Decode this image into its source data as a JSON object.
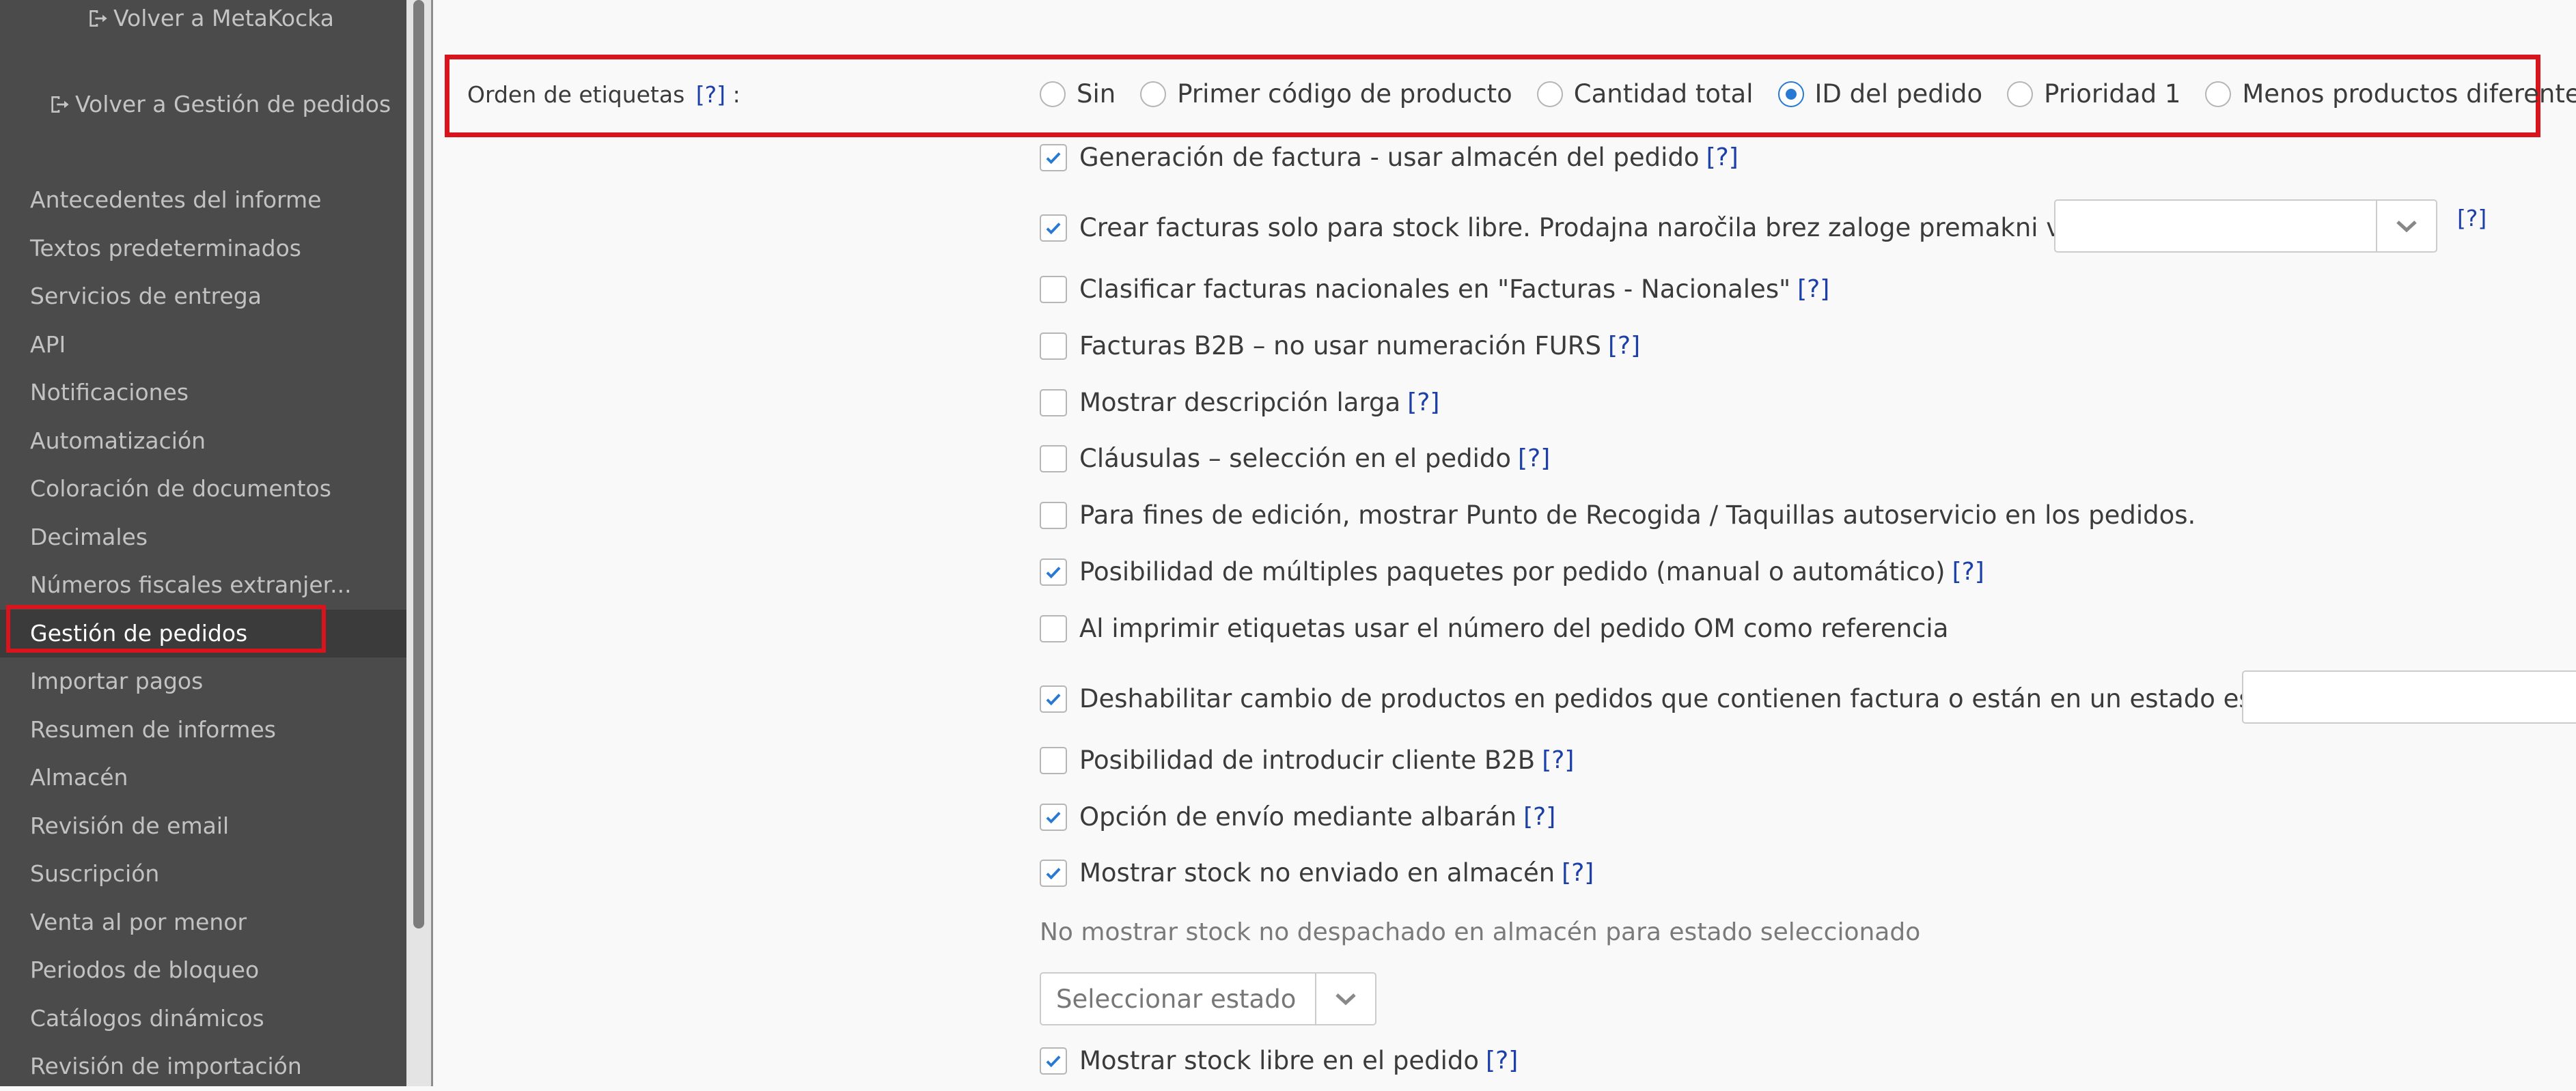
{
  "sidebar": {
    "back_metakocka": "Volver a MetaKocka",
    "back_orders": "Volver a Gestión de pedidos",
    "items": [
      {
        "label": "Antecedentes del informe"
      },
      {
        "label": "Textos predeterminados"
      },
      {
        "label": "Servicios de entrega"
      },
      {
        "label": "API"
      },
      {
        "label": "Notificaciones"
      },
      {
        "label": "Automatización"
      },
      {
        "label": "Coloración de documentos"
      },
      {
        "label": "Decimales"
      },
      {
        "label": "Números fiscales extranjer..."
      },
      {
        "label": "Gestión de pedidos",
        "active": true
      },
      {
        "label": "Importar pagos"
      },
      {
        "label": "Resumen de informes"
      },
      {
        "label": "Almacén"
      },
      {
        "label": "Revisión de email"
      },
      {
        "label": "Suscripción"
      },
      {
        "label": "Venta al por menor"
      },
      {
        "label": "Periodos de bloqueo"
      },
      {
        "label": "Catálogos dinámicos"
      },
      {
        "label": "Revisión de importación"
      }
    ]
  },
  "label_order": {
    "label": "Orden de etiquetas",
    "help": "[?]",
    "colon": ":",
    "selected": "ID del pedido",
    "options": [
      "Sin",
      "Primer código de producto",
      "Cantidad total",
      "ID del pedido",
      "Prioridad 1",
      "Menos productos diferentes"
    ]
  },
  "help_text": "[?]",
  "settings": [
    {
      "label": "Generación de factura - usar almacén del pedido",
      "checked": true,
      "help": "[?]"
    },
    {
      "label": "Crear facturas solo para stock libre. Prodajna naročila brez zaloge premakni v status",
      "checked": true,
      "help": ""
    },
    {
      "label": "Clasificar facturas nacionales en \"Facturas - Nacionales\"",
      "checked": false,
      "help": "[?]"
    },
    {
      "label": "Facturas B2B – no usar numeración FURS",
      "checked": false,
      "help": "[?]"
    },
    {
      "label": "Mostrar descripción larga",
      "checked": false,
      "help": "[?]"
    },
    {
      "label": "Cláusulas – selección en el pedido",
      "checked": false,
      "help": "[?]"
    },
    {
      "label": "Para fines de edición, mostrar Punto de Recogida / Taquillas autoservicio en los pedidos.",
      "checked": false,
      "help": ""
    },
    {
      "label": "Posibilidad de múltiples paquetes por pedido (manual o automático)",
      "checked": true,
      "help": "[?]"
    },
    {
      "label": "Al imprimir etiquetas usar el número del pedido OM como referencia",
      "checked": false,
      "help": ""
    },
    {
      "label": "Deshabilitar cambio de productos en pedidos que contienen factura o están en un estado específico",
      "checked": true,
      "help": ""
    },
    {
      "label": "Posibilidad de introducir cliente B2B",
      "checked": false,
      "help": "[?]"
    },
    {
      "label": "Opción de envío mediante albarán",
      "checked": true,
      "help": "[?]"
    },
    {
      "label": "Mostrar stock no enviado en almacén",
      "checked": true,
      "help": "[?]"
    },
    {
      "label": "Mostrar stock libre en el pedido",
      "checked": true,
      "help": "[?]"
    }
  ],
  "no_dispatched_heading": "No mostrar stock no despachado en almacén para estado seleccionado",
  "status_select_placeholder": "Seleccionar estado",
  "colors": {
    "accent": "#2879d2",
    "highlight": "#d9141c",
    "sidebar_bg": "#4b4b4b",
    "help_link": "#1c3fa8"
  }
}
